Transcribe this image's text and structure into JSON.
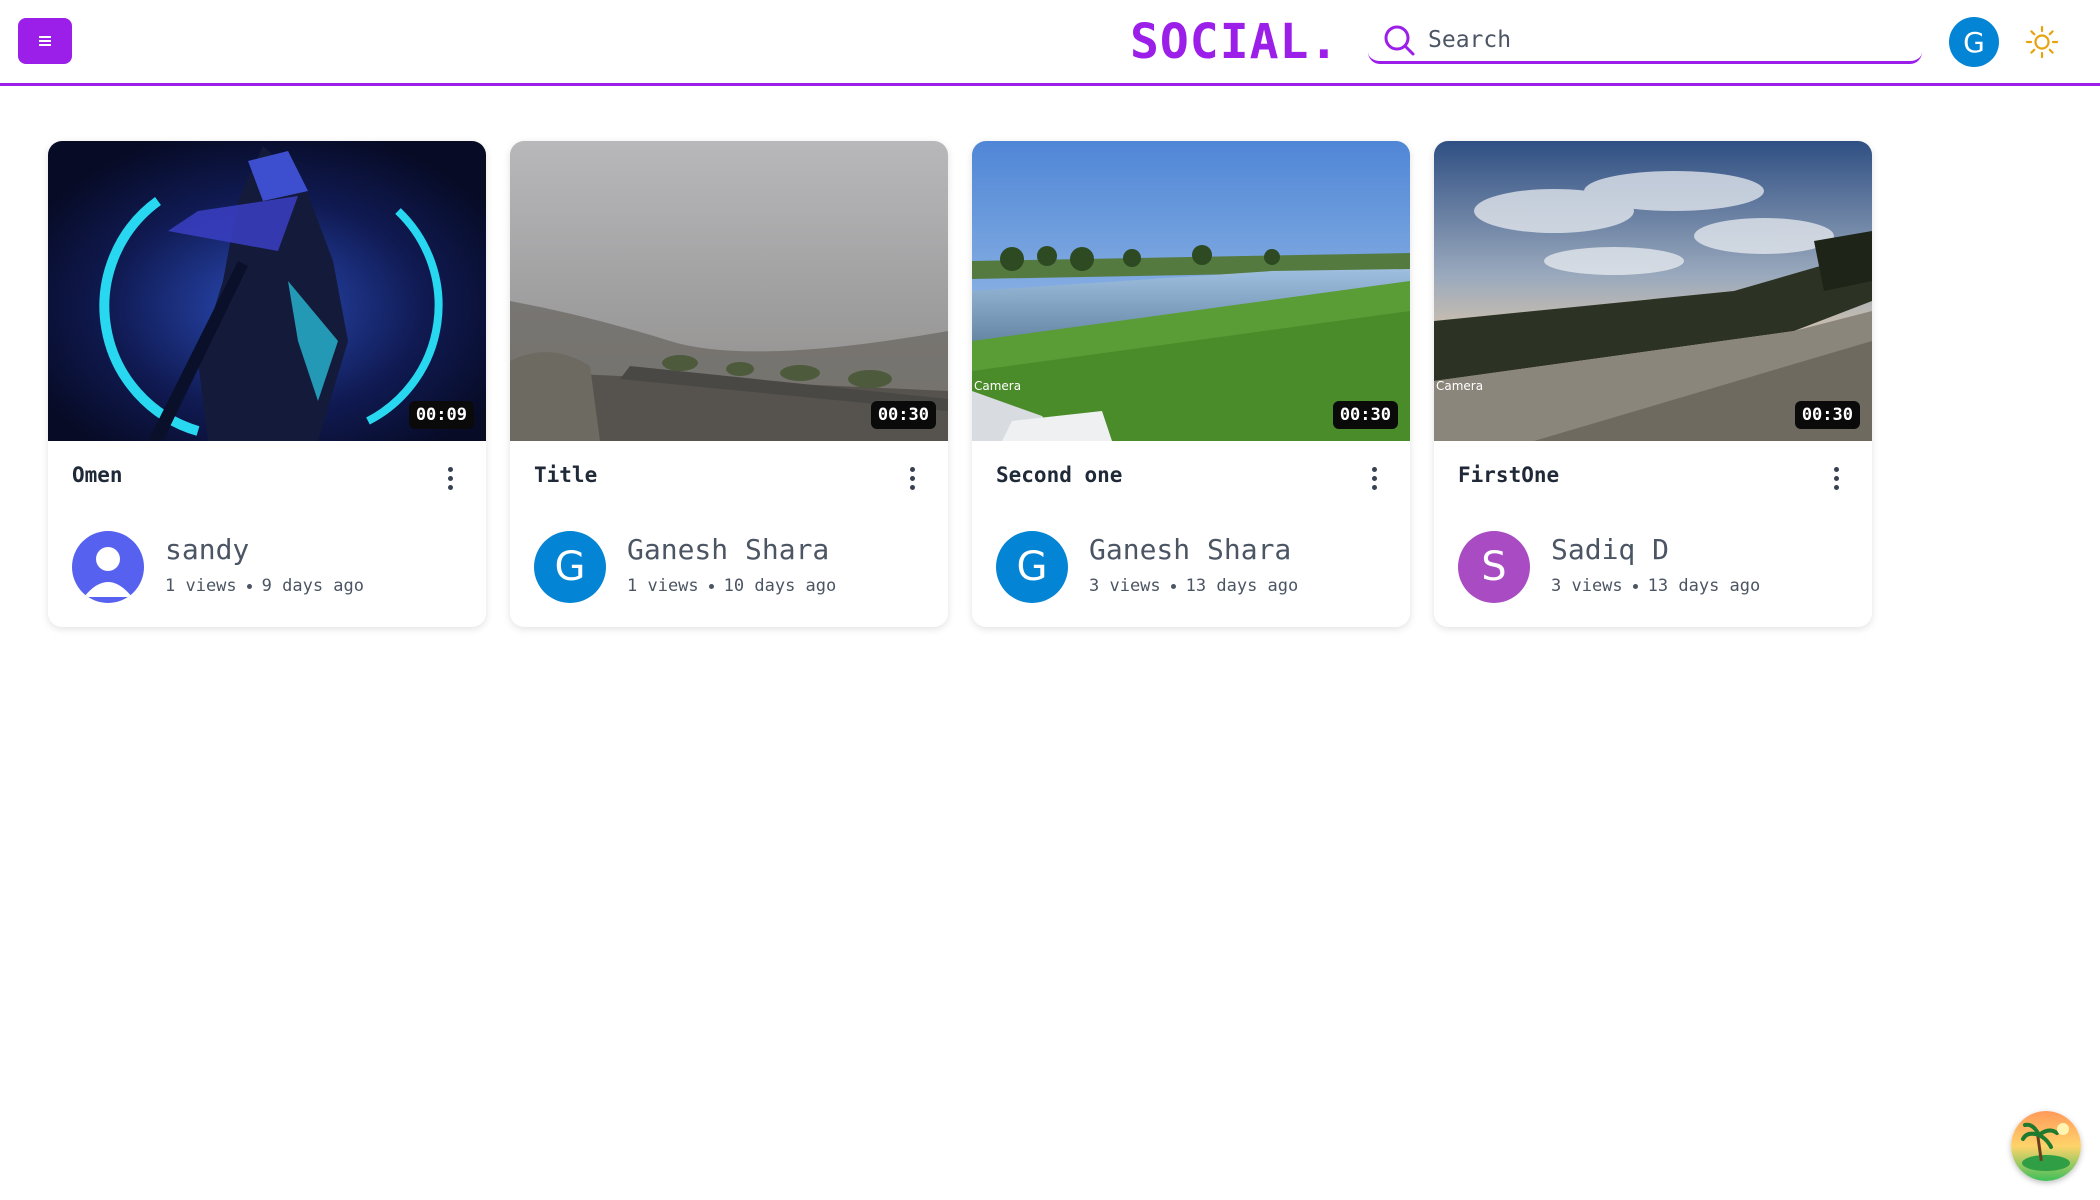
{
  "header": {
    "logo": "SOCIAL.",
    "search_placeholder": "Search",
    "user_initial": "G",
    "accent_color": "#9b1fe8"
  },
  "videos": [
    {
      "title": "Omen",
      "duration": "00:09",
      "channel": "sandy",
      "views": "1 views",
      "age": "9 days ago",
      "avatar_type": "person-icon"
    },
    {
      "title": "Title",
      "duration": "00:30",
      "channel": "Ganesh Shara",
      "views": "1 views",
      "age": "10 days ago",
      "avatar_initial": "G",
      "avatar_color": "#0384d4"
    },
    {
      "title": "Second one",
      "duration": "00:30",
      "channel": "Ganesh Shara",
      "views": "3 views",
      "age": "13 days ago",
      "avatar_initial": "G",
      "avatar_color": "#0384d4",
      "overlay": "Camera"
    },
    {
      "title": "FirstOne",
      "duration": "00:30",
      "channel": "Sadiq D",
      "views": "3 views",
      "age": "13 days ago",
      "avatar_initial": "S",
      "avatar_color": "#a94bc2",
      "overlay": "Camera"
    }
  ]
}
